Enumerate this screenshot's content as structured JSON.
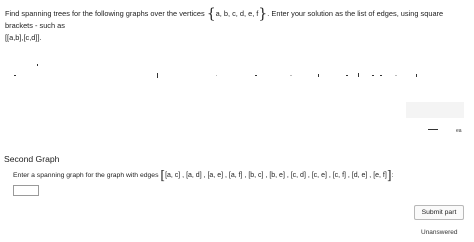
{
  "prompt": {
    "before": "Find spanning trees for the following graphs over the vertices",
    "vertices": "a, b, c, d, e, f",
    "after": ". Enter your solution as the list of edges, using square brackets - such as",
    "example": "[[a,b],[c,d]]."
  },
  "artifacts": {
    "text": "ea"
  },
  "section": {
    "title": "Second Graph",
    "question_before": "Enter a spanning graph for the graph with edges",
    "edges": "[a, c] , [a, d] , [a, e] , [a, f] , [b, c] , [b, e] , [c, d] , [c, e] , [c, f] , [d, e] , [e, f]",
    "question_after": ":"
  },
  "answer": {
    "value": "",
    "placeholder": ""
  },
  "actions": {
    "submit_label": "Submit part"
  },
  "status": {
    "text": "Unanswered"
  }
}
